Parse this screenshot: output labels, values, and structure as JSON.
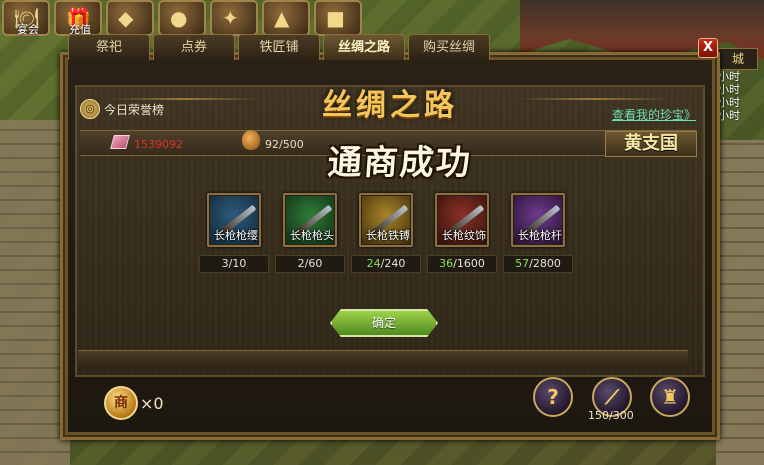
{
  "top_bar": {
    "icons": [
      {
        "name": "banquet",
        "label": "宴会",
        "glyph": "🍽"
      },
      {
        "name": "recharge",
        "label": "充值",
        "glyph": "🎁"
      },
      {
        "name": "feature-3",
        "label": "",
        "glyph": "◆"
      },
      {
        "name": "feature-4",
        "label": "",
        "glyph": "●"
      },
      {
        "name": "feature-5",
        "label": "",
        "glyph": "✦"
      },
      {
        "name": "feature-6",
        "label": "",
        "glyph": "▲"
      },
      {
        "name": "feature-7",
        "label": "",
        "glyph": "■"
      }
    ]
  },
  "side": {
    "city_label": "城",
    "timers": [
      "小时",
      "小时",
      "小时",
      "小时"
    ]
  },
  "tabs": [
    {
      "label": "祭祀",
      "active": false
    },
    {
      "label": "点券",
      "active": false
    },
    {
      "label": "铁匠铺",
      "active": false
    },
    {
      "label": "丝绸之路",
      "active": true
    },
    {
      "label": "购买丝绸",
      "active": false
    }
  ],
  "close_label": "X",
  "header": {
    "honor_label": "今日荣誉榜",
    "title": "丝绸之路",
    "treasure_link": "查看我的珍宝》"
  },
  "resources": {
    "silk_count": "1539092",
    "cargo": "92/500",
    "country": "黄支国"
  },
  "banner": "通商成功",
  "items": [
    {
      "name": "长枪枪缨",
      "have": "3",
      "need": "10",
      "met": false,
      "color": "#2d5b7c",
      "color2": "#0f2634"
    },
    {
      "name": "长枪枪头",
      "have": "2",
      "need": "60",
      "met": false,
      "color": "#2f7c3a",
      "color2": "#0e2a12"
    },
    {
      "name": "长枪铁镈",
      "have": "24",
      "need": "240",
      "met": true,
      "color": "#a9852a",
      "color2": "#3a2a08"
    },
    {
      "name": "长枪纹饰",
      "have": "36",
      "need": "1600",
      "met": true,
      "color": "#8c3226",
      "color2": "#2e0f0a"
    },
    {
      "name": "长枪枪杆",
      "have": "57",
      "need": "2800",
      "met": true,
      "color": "#6e3a8c",
      "color2": "#22102e"
    }
  ],
  "confirm_label": "确定",
  "bottom": {
    "token_glyph": "商",
    "token_count": "×0",
    "help_glyph": "?",
    "stamina": "150/300"
  },
  "colors": {
    "title_gold": "#f3c65a",
    "link_green": "#6fe0b4",
    "silk_red": "#e0302a",
    "met_green": "#8be05b",
    "confirm_green": "#9ed34a"
  }
}
